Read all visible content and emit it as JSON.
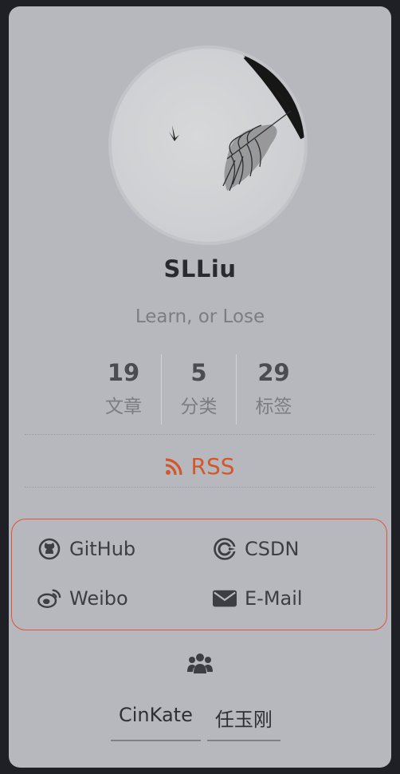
{
  "profile": {
    "name": "SLLiu",
    "motto": "Learn, or Lose"
  },
  "stats": [
    {
      "value": "19",
      "label": "文章"
    },
    {
      "value": "5",
      "label": "分类"
    },
    {
      "value": "29",
      "label": "标签"
    }
  ],
  "rss": {
    "label": "RSS",
    "color": "#d2582c"
  },
  "links": [
    {
      "label": "GitHub",
      "icon": "github-icon"
    },
    {
      "label": "CSDN",
      "icon": "csdn-icon"
    },
    {
      "label": "Weibo",
      "icon": "weibo-icon"
    },
    {
      "label": "E-Mail",
      "icon": "envelope-icon"
    }
  ],
  "friends": {
    "icon": "users-icon",
    "items": [
      "CinKate",
      "任玉刚"
    ]
  },
  "colors": {
    "accent_border": "#e0523a",
    "card_bg": "#b6b8bd",
    "page_bg": "#1e2026"
  }
}
